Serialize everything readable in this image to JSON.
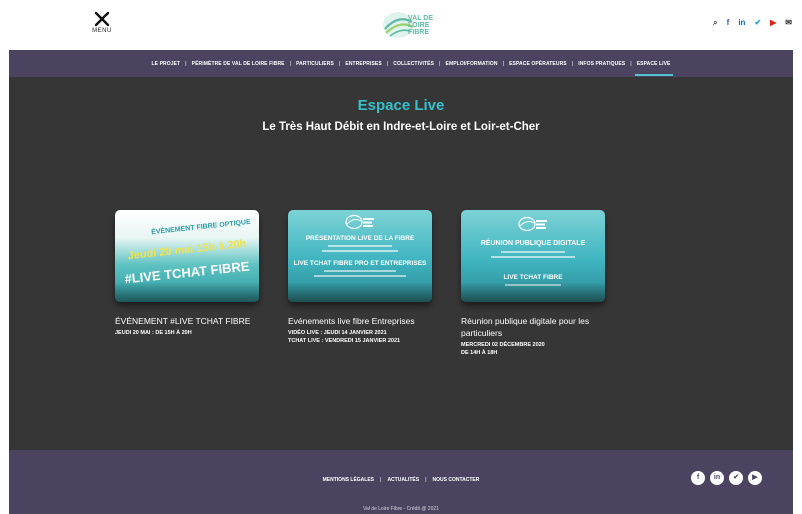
{
  "header": {
    "menu_label": "MENU",
    "logo_lines": [
      "VAL DE",
      "LOIRE",
      "FIBRE"
    ],
    "social": [
      {
        "icon": "search-icon",
        "glyph": "⌕",
        "color": "#555555"
      },
      {
        "icon": "facebook-icon",
        "glyph": "f",
        "color": "#3b5998"
      },
      {
        "icon": "linkedin-icon",
        "glyph": "in",
        "color": "#0a66c2"
      },
      {
        "icon": "twitter-icon",
        "glyph": "✔",
        "color": "#1da1f2"
      },
      {
        "icon": "youtube-icon",
        "glyph": "▶",
        "color": "#e62117"
      },
      {
        "icon": "mail-icon",
        "glyph": "✉",
        "color": "#333333"
      }
    ]
  },
  "nav": {
    "items": [
      "LE PROJET",
      "PÉRIMÈTRE DE VAL DE LOIRE FIBRE",
      "PARTICULIERS",
      "ENTREPRISES",
      "COLLECTIVITÉS",
      "EMPLOI/FORMATION",
      "ESPACE OPÉRATEURS",
      "INFOS PRATIQUES",
      "ESPACE LIVE"
    ],
    "active": "ESPACE LIVE"
  },
  "hero": {
    "title": "Espace Live",
    "subtitle": "Le Très Haut Débit en Indre-et-Loire et Loir-et-Cher"
  },
  "cards": [
    {
      "thumb_lines": [
        "ÉVÉNEMENT FIBRE OPTIQUE",
        "Jeudi 20 mai 15h à 20h",
        "#LIVE TCHAT FIBRE"
      ],
      "title": "ÉVÉNEMENT #LIVE TCHAT FIBRE",
      "meta": [
        "JEUDI 20 MAI : DE 15H À 20H"
      ]
    },
    {
      "thumb_lines": [
        "PRÉSENTATION LIVE DE LA FIBRE",
        "LIVE TCHAT FIBRE PRO ET ENTREPRISES"
      ],
      "title": "Evénements live fibre Entreprises",
      "meta": [
        "VIDÉO LIVE : JEUDI 14 JANVIER 2021",
        "TCHAT LIVE : VENDREDI 15 JANVIER 2021"
      ]
    },
    {
      "thumb_lines": [
        "RÉUNION PUBLIQUE DIGITALE",
        "LIVE TCHAT FIBRE"
      ],
      "title": "Réunion publique digitale pour les particuliers",
      "meta": [
        "MERCREDI 02 DÉCEMBRE 2020",
        "DE 14H À 18H"
      ]
    }
  ],
  "footer": {
    "links": [
      "MENTIONS LÉGALES",
      "ACTUALITÉS",
      "NOUS CONTACTER"
    ],
    "social": [
      {
        "icon": "facebook-icon",
        "glyph": "f"
      },
      {
        "icon": "linkedin-icon",
        "glyph": "in"
      },
      {
        "icon": "twitter-icon",
        "glyph": "✔"
      },
      {
        "icon": "youtube-icon",
        "glyph": "▶"
      }
    ],
    "credit": "Val de Loire Fibre - Crédit @ 2021"
  },
  "colors": {
    "accent": "#35c0cc",
    "nav_bg": "#4b4360",
    "main_bg": "#363636"
  }
}
